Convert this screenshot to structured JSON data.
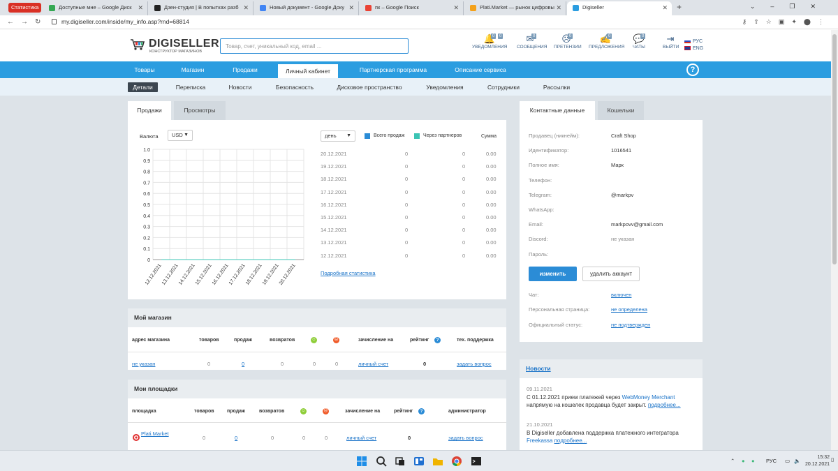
{
  "browser": {
    "badge": "Статистика",
    "tabs": [
      {
        "label": "Доступные мне – Google Диск",
        "color": "#34a853"
      },
      {
        "label": "Дзен-студия | В попытках разб",
        "color": "#222222"
      },
      {
        "label": "Новый документ - Google Доку",
        "color": "#4285f4"
      },
      {
        "label": "пк – Google Поиск",
        "color": "#ea4335"
      },
      {
        "label": "Plati.Market — рынок цифровы",
        "color": "#f4a11a"
      },
      {
        "label": "Digiseller",
        "color": "#2b9de0"
      }
    ],
    "new_tab": "+",
    "url": "my.digiseller.com/inside/my_info.asp?rnd=68814"
  },
  "header": {
    "brand": "DIGISELLER",
    "brand_sub": "КОНСТРУКТОР МАГАЗИНОВ",
    "search_placeholder": "Товар, счет, уникальный код, email ...",
    "icons": [
      {
        "name": "notifications",
        "label": "УВЕДОМЛЕНИЯ",
        "glyph": "🔔",
        "counts": [
          "0",
          "0"
        ]
      },
      {
        "name": "messages",
        "label": "СООБЩЕНИЯ",
        "glyph": "✉",
        "counts": [
          "0"
        ]
      },
      {
        "name": "claims",
        "label": "ПРЕТЕНЗИИ",
        "glyph": "☹",
        "counts": [
          "0"
        ]
      },
      {
        "name": "offers",
        "label": "ПРЕДЛОЖЕНИЯ",
        "glyph": "✍",
        "counts": [
          "0"
        ]
      },
      {
        "name": "chats",
        "label": "ЧАТЫ",
        "glyph": "💬",
        "counts": [
          "0"
        ]
      },
      {
        "name": "logout",
        "label": "ВЫЙТИ",
        "glyph": "⇥",
        "counts": []
      }
    ],
    "lang_ru": "РУС",
    "lang_en": "ENG"
  },
  "nav": {
    "items": [
      "Товары",
      "Магазин",
      "Продажи",
      "Личный кабинет",
      "Партнерская программа",
      "Описание сервиса"
    ],
    "active": "Личный кабинет",
    "help": "?"
  },
  "subnav": {
    "items": [
      "Детали",
      "Переписка",
      "Новости",
      "Безопасность",
      "Дисковое пространство",
      "Уведомления",
      "Сотрудники",
      "Рассылки"
    ],
    "active": "Детали"
  },
  "stats": {
    "tabs": [
      "Продажи",
      "Просмотры"
    ],
    "currency_label": "Валюта",
    "currency_value": "USD",
    "period_value": "день",
    "legend_all": "Всего продаж",
    "legend_partners": "Через партнеров",
    "sum_header": "Сумма",
    "rows": [
      {
        "date": "20.12.2021",
        "all": "0",
        "partners": "0",
        "sum": "0.00"
      },
      {
        "date": "19.12.2021",
        "all": "0",
        "partners": "0",
        "sum": "0.00"
      },
      {
        "date": "18.12.2021",
        "all": "0",
        "partners": "0",
        "sum": "0.00"
      },
      {
        "date": "17.12.2021",
        "all": "0",
        "partners": "0",
        "sum": "0.00"
      },
      {
        "date": "16.12.2021",
        "all": "0",
        "partners": "0",
        "sum": "0.00"
      },
      {
        "date": "15.12.2021",
        "all": "0",
        "partners": "0",
        "sum": "0.00"
      },
      {
        "date": "14.12.2021",
        "all": "0",
        "partners": "0",
        "sum": "0.00"
      },
      {
        "date": "13.12.2021",
        "all": "0",
        "partners": "0",
        "sum": "0.00"
      },
      {
        "date": "12.12.2021",
        "all": "0",
        "partners": "0",
        "sum": "0.00"
      }
    ],
    "detail_link": "Подробная статистика",
    "colors": {
      "all": "#2b8cd6",
      "partners": "#3cc4b4"
    }
  },
  "chart_data": {
    "type": "line",
    "x": [
      "12.12.2021",
      "13.12.2021",
      "14.12.2021",
      "15.12.2021",
      "16.12.2021",
      "17.12.2021",
      "18.12.2021",
      "19.12.2021",
      "20.12.2021"
    ],
    "series": [
      {
        "values": [
          0,
          0,
          0,
          0,
          0,
          0,
          0,
          0,
          0
        ]
      },
      {
        "values": [
          0,
          0,
          0,
          0,
          0,
          0,
          0,
          0,
          0
        ]
      }
    ],
    "yticks": [
      "1.0",
      "0.9",
      "0.8",
      "0.7",
      "0.6",
      "0.5",
      "0.4",
      "0.3",
      "0.2",
      "0.1",
      "0"
    ],
    "ylim": [
      0,
      1.0
    ],
    "grid": true
  },
  "my_shop": {
    "title": "Мой магазин",
    "headers": [
      "адрес магазина",
      "товаров",
      "продаж",
      "возвратов",
      "",
      "",
      "зачисление на",
      "рейтинг",
      "тех. поддержка"
    ],
    "row": {
      "address": "не указан",
      "goods": "0",
      "sales": "0",
      "returns": "0",
      "pos": "0",
      "neg": "0",
      "account": "личный счет",
      "rating": "0",
      "support": "задать вопрос"
    }
  },
  "my_platforms": {
    "title": "Мои площадки",
    "headers": [
      "площадка",
      "товаров",
      "продаж",
      "возвратов",
      "",
      "",
      "зачисление на",
      "рейтинг",
      "администратор"
    ],
    "row": {
      "platform": "Plati.Market",
      "goods": "0",
      "sales": "0",
      "returns": "0",
      "pos": "0",
      "neg": "0",
      "account": "личный счет",
      "rating": "0",
      "admin": "задать вопрос"
    }
  },
  "contacts": {
    "tabs": [
      "Контактные данные",
      "Кошельки"
    ],
    "fields": [
      {
        "label": "Продавец (никнейм):",
        "value": "Craft Shop",
        "style": "plain"
      },
      {
        "label": "Идентификатор:",
        "value": "1016541",
        "style": "plain"
      },
      {
        "label": "Полное имя:",
        "value": "Марк",
        "style": "plain"
      },
      {
        "label": "Телефон:",
        "value": "",
        "style": "plain"
      },
      {
        "label": "Telegram:",
        "value": "@markpv",
        "style": "plain"
      },
      {
        "label": "WhatsApp:",
        "value": "",
        "style": "plain"
      },
      {
        "label": "Email:",
        "value": "markpovv@gmail.com",
        "style": "plain"
      },
      {
        "label": "Discord:",
        "value": "не указан",
        "style": "muted"
      },
      {
        "label": "Пароль:",
        "value": "",
        "style": "plain"
      }
    ],
    "edit_button": "изменить",
    "delete_button": "удалить аккаунт",
    "extra": [
      {
        "label": "Чат:",
        "value": "включен"
      },
      {
        "label": "Персональная страница:",
        "value": "не определена"
      },
      {
        "label": "Официальный статус:",
        "value": "не подтвержден"
      }
    ]
  },
  "news": {
    "title": "Новости",
    "items": [
      {
        "date": "09.11.2021",
        "pre": "С 01.12.2021 прием платежей через ",
        "link1": "WebMoney Merchant",
        "mid": " напрямую на кошелек продавца будет закрыт. ",
        "more": "подробнее..."
      },
      {
        "date": "21.10.2021",
        "pre": "В Digiseller добавлена поддержка платежного интегратора ",
        "link1": "Freekassa",
        "mid": " ",
        "more": "подробнее..."
      }
    ]
  },
  "taskbar": {
    "lang": "РУС",
    "time": "15:32",
    "date": "20.12.2021"
  }
}
